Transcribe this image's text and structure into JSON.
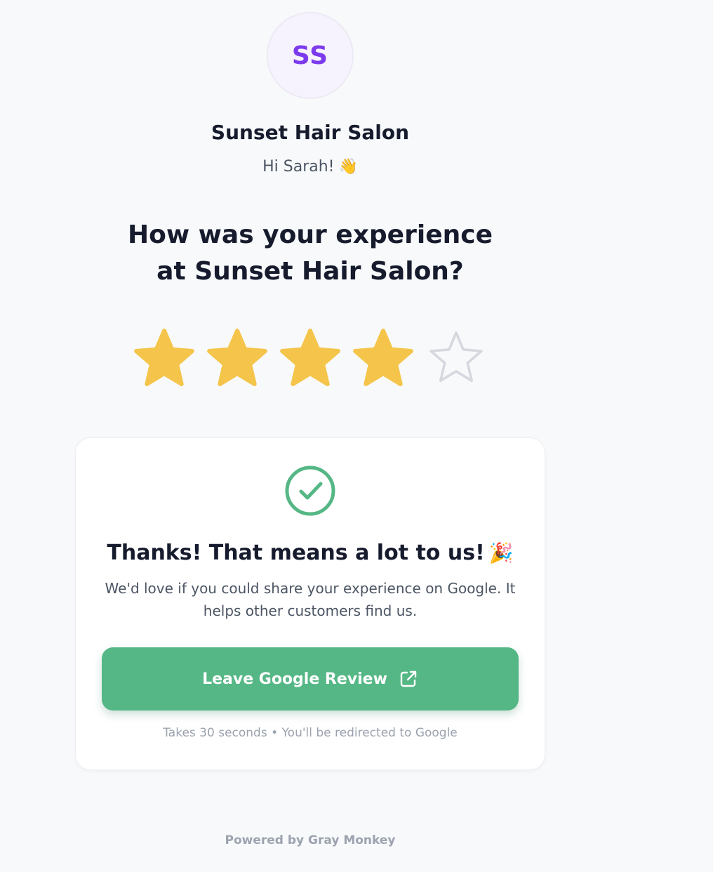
{
  "business": {
    "initials": "SS",
    "name": "Sunset Hair Salon"
  },
  "greeting": {
    "text": "Hi Sarah!",
    "emoji": "👋"
  },
  "question": "How was your experience at Sunset Hair Salon?",
  "rating": {
    "value": 4,
    "max": 5,
    "filled_color": "#f4c54a",
    "empty_color": "#d6d8df"
  },
  "thanks_card": {
    "icon": "check-circle-icon",
    "icon_color": "#55b785",
    "title": "Thanks! That means a lot to us!",
    "title_emoji": "🎉",
    "message": "We'd love if you could share your experience on Google. It helps other customers find us.",
    "button_label": "Leave Google Review",
    "button_icon": "external-link-icon",
    "button_color": "#55b785",
    "footnote": "Takes 30 seconds • You'll be redirected to Google"
  },
  "footer": {
    "powered_by": "Powered by Gray Monkey"
  }
}
